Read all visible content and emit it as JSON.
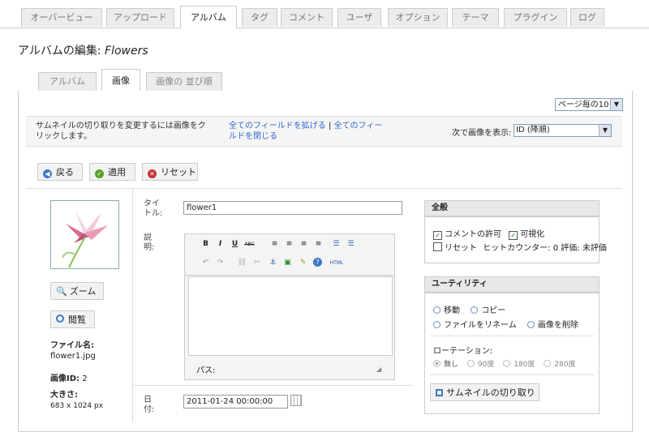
{
  "top_tabs": [
    "オーバービュー",
    "アップロード",
    "アルバム",
    "タグ",
    "コメント",
    "ユーザ",
    "オプション",
    "テーマ",
    "プラグイン",
    "ログ"
  ],
  "page_title_prefix": "アルバムの編集: ",
  "page_title_album": "Flowers",
  "sub_tabs": [
    "アルバム",
    "画像",
    "画像の 並び順"
  ],
  "per_page": "ページ毎の10",
  "info": {
    "hint_line1": "サムネイルの切り取りを変更するには画像をク",
    "hint_line2": "リックします。",
    "expand_all": "全てのフィールドを拡げる",
    "pipe": "|",
    "collapse_all_1": "全てのフィー",
    "collapse_all_2": "ルドを閉じる",
    "sort_label": "次で画像を表示:",
    "sort_value": "ID (降順)"
  },
  "actions": {
    "back": "戻る",
    "apply": "適用",
    "reset": "リセット"
  },
  "image": {
    "zoom": "ズーム",
    "view": "閲覧",
    "filename_label": "ファイル名:",
    "filename": "flower1.jpg",
    "id_label": "画像ID:",
    "id": "2",
    "size_label": "大きさ:",
    "size": "683 x 1024 px"
  },
  "form": {
    "title_label_1": "タイ",
    "title_label_2": "トル:",
    "title_value": "flower1",
    "desc_label_1": "説",
    "desc_label_2": "明:",
    "path_label": "パス:",
    "date_label_1": "日",
    "date_label_2": "付:",
    "date_value": "2011-01-24 00:00:00"
  },
  "toolbar": [
    "B",
    "I",
    "U",
    "ABC",
    "≡",
    "≡",
    "≡",
    "≡",
    "☰",
    "☰",
    "↶",
    "↷",
    "⛓",
    "✂",
    "⚓",
    "▣",
    "✎",
    "?",
    "HTML"
  ],
  "general": {
    "header": "全般",
    "allow_comments": "コメントの許可",
    "visible": "可視化",
    "reset": "リセット",
    "hit_counter": "ヒットカウンター: 0",
    "rating": "評価: 未評価"
  },
  "utility": {
    "header": "ユーティリティ",
    "move": "移動",
    "copy": "コピー",
    "rename": "ファイルをリネーム",
    "delete": "画像を削除",
    "rotation_label": "ローテーション:",
    "rot_none": "無し",
    "rot_90": "90度",
    "rot_180": "180度",
    "rot_270": "280度",
    "crop_thumb": "サムネイルの切り取り"
  }
}
